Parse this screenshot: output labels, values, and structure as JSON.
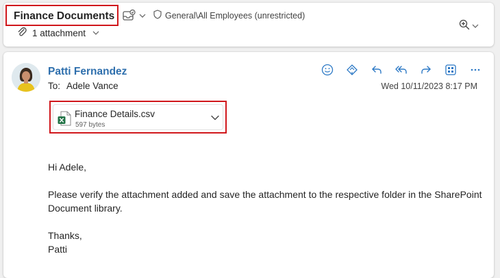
{
  "header": {
    "subject": "Finance Documents",
    "sensitivity_label": "General\\All Employees (unrestricted)",
    "attachment_count": "1 attachment"
  },
  "message": {
    "sender_name": "Patti Fernandez",
    "to_label": "To:",
    "recipient": "Adele Vance",
    "date": "Wed 10/11/2023 8:17 PM",
    "actions": [
      "smile-icon",
      "immersive-reader-icon",
      "reply-icon",
      "reply-all-icon",
      "forward-icon",
      "apps-icon",
      "more-icon"
    ],
    "attachment": {
      "file_name": "Finance Details.csv",
      "file_size": "597 bytes",
      "icon": "excel-file-icon"
    },
    "body": {
      "greeting": "Hi Adele,",
      "paragraph": "Please verify the attachment added and save the attachment to the respective folder in the SharePoint Document library.",
      "signoff": "Thanks,",
      "signature": "Patti"
    }
  },
  "colors": {
    "highlight_border": "#d0161b",
    "sender_blue": "#2e6fad",
    "icon_blue": "#2b78c5",
    "excel_green": "#217346"
  }
}
